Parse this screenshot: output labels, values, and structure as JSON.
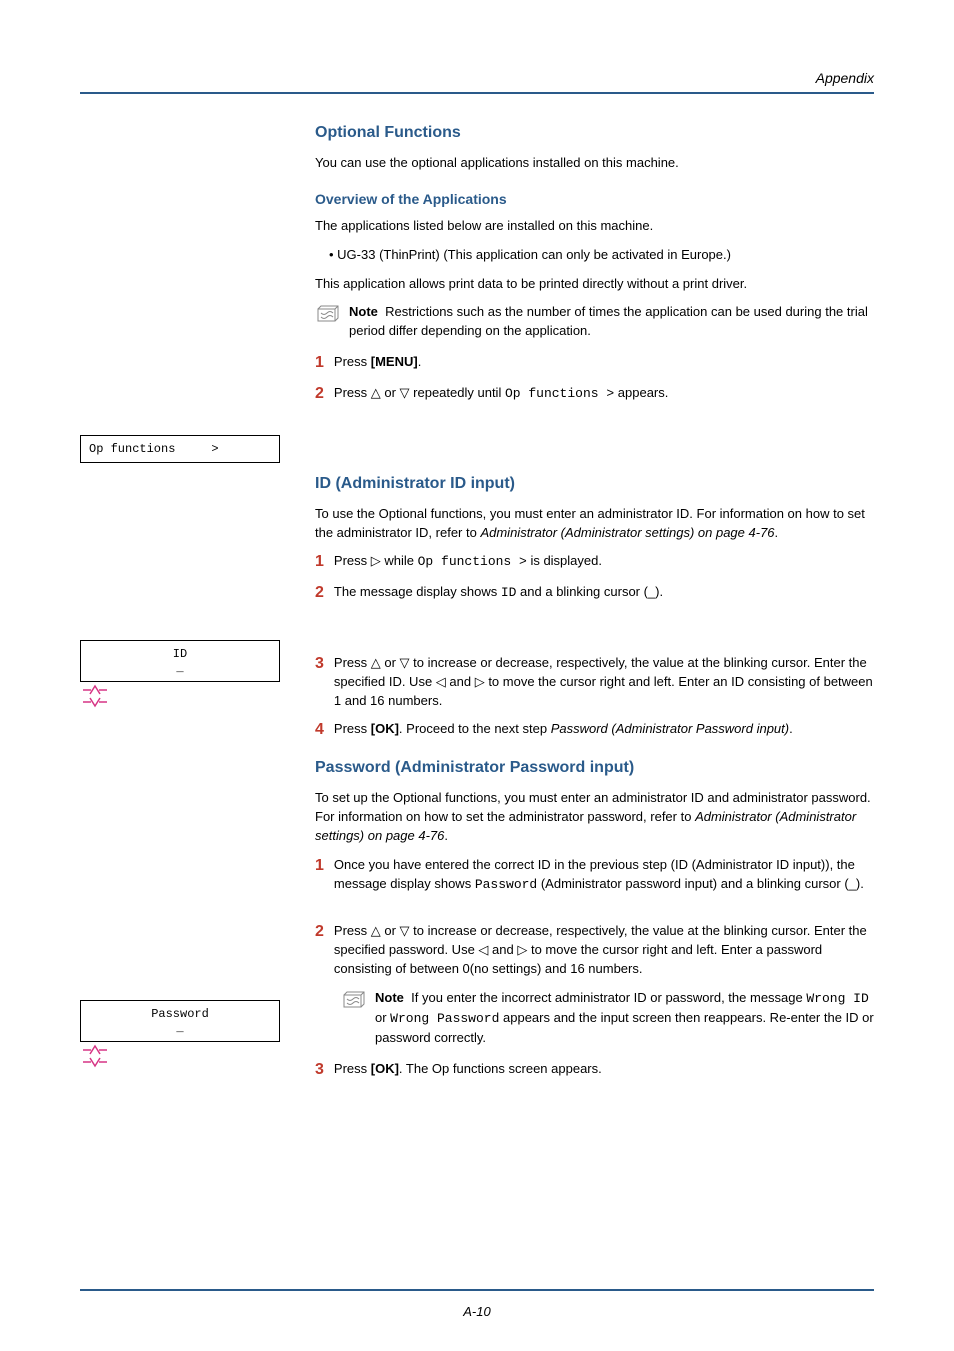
{
  "header": {
    "appendix": "Appendix"
  },
  "section1": {
    "title": "Optional Functions",
    "intro": "You can use the optional applications installed on this machine.",
    "overview_title": "Overview of the Applications",
    "overview_intro": "The applications listed below are installed on this machine.",
    "bullet1": "•   UG-33 (ThinPrint) (This application can only be activated in Europe.)",
    "overview_para": "This application allows print data to be printed directly without a print driver.",
    "note": "Restrictions such as the number of times the application can be used during the trial period differ depending on the application.",
    "note_label": "Note",
    "step1_pre": "Press ",
    "step1_key": "[MENU]",
    "step1_post": ".",
    "step2_pre": "Press ",
    "step2_mid": " or ",
    "step2_after": " repeatedly until ",
    "step2_code": "Op functions >",
    "step2_end": " appears.",
    "display1": "Op functions     >"
  },
  "section2": {
    "title": "ID (Administrator ID input)",
    "intro_pre": "To use the Optional functions, you must enter an administrator ID. For information on how to set the administrator ID, refer to ",
    "intro_italic": "Administrator (Administrator settings) on page 4-76",
    "intro_post": ".",
    "step1_pre": "Press ",
    "step1_mid": " while ",
    "step1_code": "Op functions >",
    "step1_end": " is displayed.",
    "step2_pre": "The message display shows ",
    "step2_code": "ID",
    "step2_end": " and a blinking cursor (_).",
    "display2": "ID\n_",
    "step3_pre": "Press ",
    "step3_mid": " or ",
    "step3_after": " to increase or decrease, respectively, the value at the blinking cursor. Enter the specified ID. Use ",
    "step3_mid2": " and ",
    "step3_after2": " to move the cursor right and left. Enter an ID consisting of between 1 and 16 numbers.",
    "step4_pre": "Press ",
    "step4_key": "[OK]",
    "step4_mid": ". Proceed to the next step ",
    "step4_italic": "Password (Administrator Password input)",
    "step4_post": "."
  },
  "section3": {
    "title": "Password (Administrator Password input)",
    "intro_pre": "To set up the Optional functions, you must enter an administrator ID and administrator password. For information on how to set the administrator password, refer to ",
    "intro_italic": "Administrator (Administrator settings) on page 4-76",
    "intro_post": ".",
    "step1_text_pre": "Once you have entered the correct ID in the previous step (ID (Administrator ID input)), the message display shows ",
    "step1_code": "Password",
    "step1_text_post": " (Administrator password input) and a blinking cursor (_).",
    "display3": "Password\n_",
    "step2_pre": "Press ",
    "step2_mid": " or ",
    "step2_after": " to increase or decrease, respectively, the value at the blinking cursor. Enter the specified password. Use ",
    "step2_mid2": " and ",
    "step2_after2": " to move the cursor right and left. Enter a password consisting of between 0(no settings) and 16 numbers.",
    "note_label": "Note",
    "note_pre": "If you enter the incorrect administrator ID or password, the message ",
    "note_code1": "Wrong ID",
    "note_mid": " or ",
    "note_code2": "Wrong Password",
    "note_post": " appears and the input screen then reappears. Re-enter the ID or password correctly.",
    "step3_pre": "Press ",
    "step3_key": "[OK]",
    "step3_post": ". The Op functions screen appears."
  },
  "footer": {
    "page": "A-10"
  },
  "symbols": {
    "up": "△",
    "down": "▽",
    "right": "▷",
    "left": "◁"
  }
}
